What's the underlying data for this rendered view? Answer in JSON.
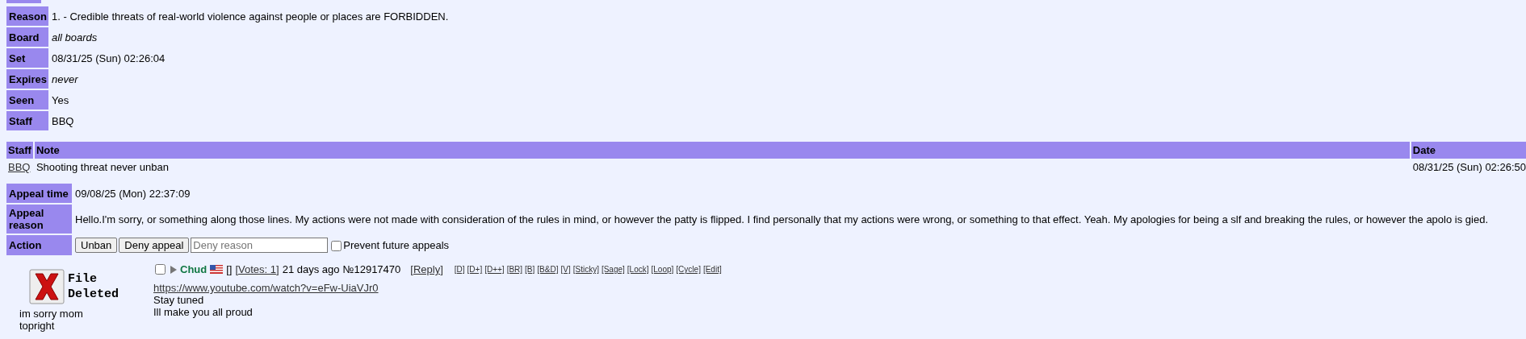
{
  "ban_details": [
    {
      "label": "Reason",
      "value": "1. - Credible threats of real-world violence against people or places are FORBIDDEN.",
      "italic": false
    },
    {
      "label": "Board",
      "value": "all boards",
      "italic": true
    },
    {
      "label": "Set",
      "value": "08/31/25 (Sun) 02:26:04",
      "italic": false
    },
    {
      "label": "Expires",
      "value": "never",
      "italic": true
    },
    {
      "label": "Seen",
      "value": "Yes",
      "italic": false
    },
    {
      "label": "Staff",
      "value": "BBQ",
      "italic": false
    }
  ],
  "notes": {
    "columns": [
      "Staff",
      "Note",
      "Date"
    ],
    "rows": [
      {
        "staff": "BBQ",
        "note": "Shooting threat never unban",
        "date": "08/31/25 (Sun) 02:26:50"
      }
    ]
  },
  "appeal": {
    "time_label": "Appeal time",
    "time": "09/08/25 (Mon) 22:37:09",
    "reason_label": "Appeal reason",
    "reason": "Hello.I'm sorry, or something along those lines. My actions were not made with consideration of the rules in mind, or however the patty is flipped. I find personally that my actions were wrong, or something to that effect. Yeah. My apologies for being a slf and breaking the rules, or however the apolo is gied.",
    "action_label": "Action",
    "buttons": [
      "Unban",
      "Deny appeal"
    ],
    "deny_placeholder": "Deny reason",
    "prevent_label": "Prevent future appeals",
    "prevent_checked": false
  },
  "post": {
    "file_deleted": "File Deleted",
    "filename_lines": [
      "im sorry mom",
      "topright"
    ],
    "checked": false,
    "name": "Chud",
    "bracket": "[]",
    "votes": "[Votes: 1]",
    "age": "21 days ago",
    "number": "№12917470",
    "reply": "[Reply]",
    "mod_links": [
      "[D]",
      "[D+]",
      "[D++]",
      "[BR]",
      "[B]",
      "[B&D]",
      "[V]",
      "[Sticky]",
      "[Sage]",
      "[Lock]",
      "[Loop]",
      "[Cycle]",
      "[Edit]"
    ],
    "link": "https://www.youtube.com/watch?v=eFw-UiaVJr0",
    "lines": [
      "Stay tuned",
      "Ill make you all proud"
    ]
  }
}
